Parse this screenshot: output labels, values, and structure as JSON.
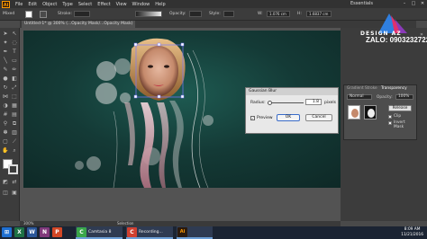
{
  "menubar": {
    "app_icon": "Ai",
    "items": [
      "File",
      "Edit",
      "Object",
      "Type",
      "Select",
      "Effect",
      "View",
      "Window",
      "Help"
    ],
    "workspace": "Essentials"
  },
  "control": {
    "selection_label": "Mixed",
    "stroke_label": "Stroke:",
    "opacity_label": "Opacity:",
    "style_label": "Style:",
    "w_label": "W:",
    "w_value": "1.076 cm",
    "h_label": "H:",
    "h_value": "1.6837 cm"
  },
  "doc_tab": {
    "title": "Untitled-1* @ 300% (...Opacity Mask/...Opacity Mask)"
  },
  "dialog": {
    "title": "Gaussian Blur",
    "radius_label": "Radius:",
    "radius_value": "1.8",
    "radius_unit": "pixels",
    "preview_label": "Preview",
    "ok_label": "OK",
    "cancel_label": "Cancel"
  },
  "transparency_panel": {
    "tabs": [
      "Gradient",
      "Stroke",
      "Transparency"
    ],
    "mode": "Normal",
    "opacity_label": "Opacity:",
    "opacity_value": "100%",
    "release_label": "Release",
    "clip_label": "Clip",
    "invert_label": "Invert Mask"
  },
  "statusbar": {
    "zoom": "300%",
    "tool": "Selection"
  },
  "taskbar": {
    "apps": [
      {
        "label": "Camtasia 8",
        "color": "#3aa64a",
        "letter": "C"
      },
      {
        "label": "Recording...",
        "color": "#d04030",
        "letter": "C"
      },
      {
        "label": "Ai",
        "color": "#ff9a00",
        "letter": "Ai"
      }
    ],
    "clock_time": "8:09 AM",
    "clock_date": "11/21/2016"
  },
  "watermark": {
    "brand": "DESIGN AZ",
    "phone": "ZALO: 0903232722"
  }
}
